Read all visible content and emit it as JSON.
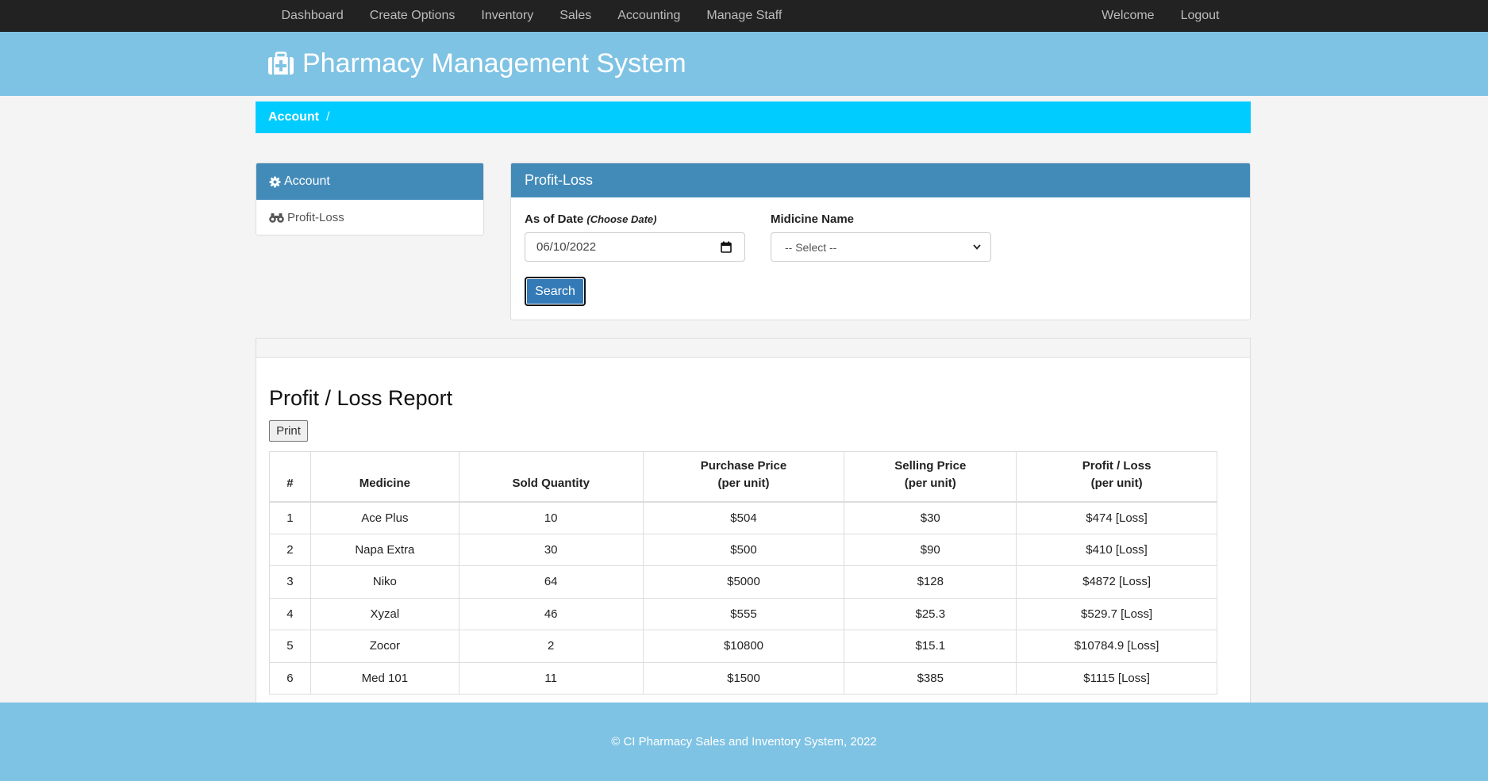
{
  "nav": {
    "left": [
      "Dashboard",
      "Create Options",
      "Inventory",
      "Sales",
      "Accounting",
      "Manage Staff"
    ],
    "right": [
      "Welcome",
      "Logout"
    ]
  },
  "header": {
    "title": "Pharmacy Management System",
    "icon": "medical-kit-icon"
  },
  "breadcrumb": {
    "current": "Account",
    "separator": "/"
  },
  "sidebar": {
    "title": "Account",
    "title_icon": "gear-icon",
    "items": [
      {
        "label": "Profit-Loss",
        "icon": "binoculars-icon"
      }
    ]
  },
  "form": {
    "title": "Profit-Loss",
    "date_label": "As of Date",
    "date_hint": "(Choose Date)",
    "date_value": "06/10/2022",
    "medicine_label": "Midicine Name",
    "medicine_selected": "-- Select --",
    "search_label": "Search"
  },
  "report": {
    "title": "Profit / Loss Report",
    "print_label": "Print",
    "columns": [
      {
        "line1": "#",
        "line2": ""
      },
      {
        "line1": "Medicine",
        "line2": ""
      },
      {
        "line1": "Sold Quantity",
        "line2": ""
      },
      {
        "line1": "Purchase Price",
        "line2": "(per unit)"
      },
      {
        "line1": "Selling Price",
        "line2": "(per unit)"
      },
      {
        "line1": "Profit / Loss",
        "line2": "(per unit)"
      }
    ],
    "rows": [
      [
        "1",
        "Ace Plus",
        "10",
        "$504",
        "$30",
        "$474 [Loss]"
      ],
      [
        "2",
        "Napa Extra",
        "30",
        "$500",
        "$90",
        "$410 [Loss]"
      ],
      [
        "3",
        "Niko",
        "64",
        "$5000",
        "$128",
        "$4872 [Loss]"
      ],
      [
        "4",
        "Xyzal",
        "46",
        "$555",
        "$25.3",
        "$529.7 [Loss]"
      ],
      [
        "5",
        "Zocor",
        "2",
        "$10800",
        "$15.1",
        "$10784.9 [Loss]"
      ],
      [
        "6",
        "Med 101",
        "11",
        "$1500",
        "$385",
        "$1115 [Loss]"
      ]
    ]
  },
  "footer": {
    "text": "© CI Pharmacy Sales and Inventory System, 2022"
  },
  "colors": {
    "header": "#7fc3e4",
    "breadcrumb": "#00ccff",
    "panel_heading": "#428bb9",
    "search_button": "#337ab7",
    "navbar": "#222222"
  }
}
